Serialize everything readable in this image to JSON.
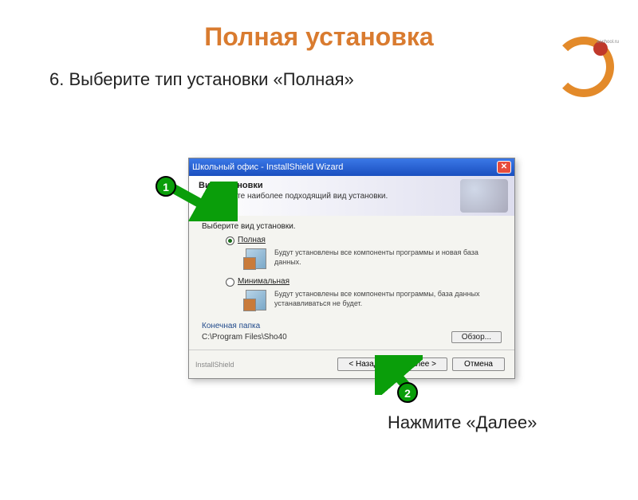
{
  "slide": {
    "title": "Полная установка",
    "step_instruction": "6. Выберите тип установки «Полная»",
    "bottom_text": "Нажмите «Далее»",
    "logo_domain": "eschool.ru"
  },
  "callouts": {
    "badge1": "1",
    "badge2": "2"
  },
  "dialog": {
    "title": "Школьный офис - InstallShield Wizard",
    "header_title": "Вид установки",
    "header_sub": "Выберите наиболее подходящий вид установки.",
    "choose_label": "Выберите вид установки.",
    "option_full": {
      "label": "Полная",
      "desc": "Будут установлены все компоненты программы и новая база данных."
    },
    "option_min": {
      "label": "Минимальная",
      "desc": "Будут установлены все компоненты программы, база данных устанавливаться не будет."
    },
    "dest_label": "Конечная папка",
    "dest_path": "C:\\Program Files\\Sho40",
    "browse_btn": "Обзор...",
    "installshield_tag": "InstallShield",
    "back_btn": "< Назад",
    "next_btn": "Далее >",
    "cancel_btn": "Отмена"
  }
}
